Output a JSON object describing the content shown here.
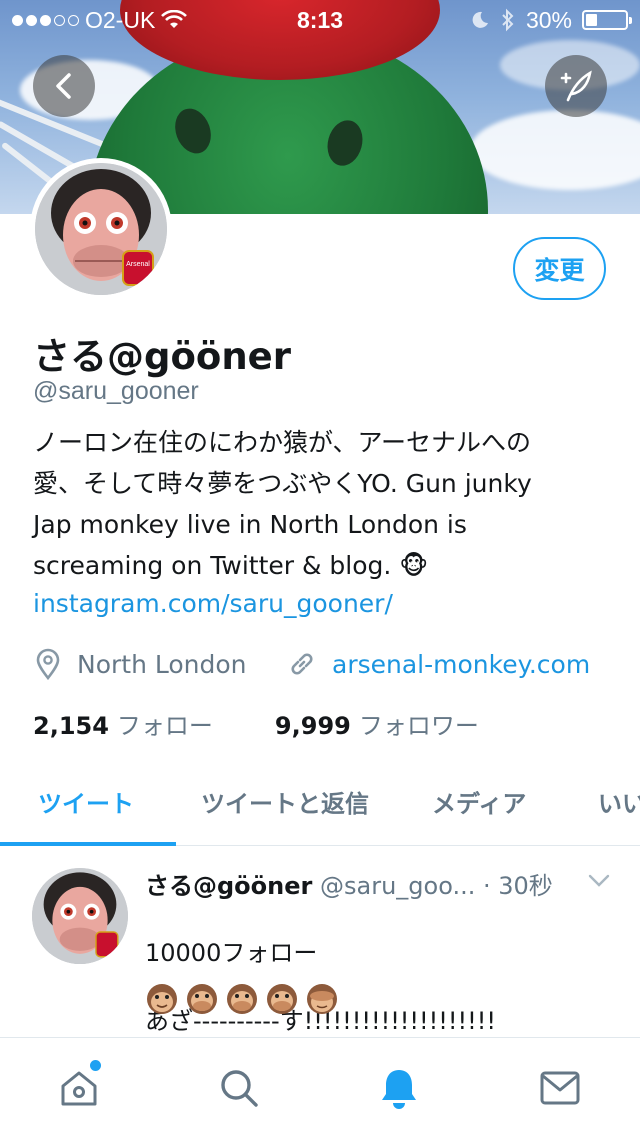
{
  "status_bar": {
    "carrier": "O2-UK",
    "time": "8:13",
    "battery": "30%",
    "battery_level": 0.3
  },
  "profile": {
    "name": "さる@gööner",
    "handle": "@saru_gooner",
    "edit_label": "変更",
    "bio_line1": "ノーロン在住のにわか猿が、アーセナルへの",
    "bio_line2": "愛、そして時々夢をつぶやくYO. Gun junky",
    "bio_line3": "Jap monkey live in North London is",
    "bio_line4": "screaming on Twitter & blog. 🐵",
    "bio_link": "instagram.com/saru_gooner/",
    "location": "North London",
    "website": "arsenal-monkey.com",
    "following_count": "2,154",
    "following_label": "フォロー",
    "followers_count": "9,999",
    "followers_label": "フォロワー"
  },
  "tabs": [
    {
      "label": "ツイート",
      "active": true
    },
    {
      "label": "ツイートと返信",
      "active": false
    },
    {
      "label": "メディア",
      "active": false
    },
    {
      "label": "いい",
      "active": false
    }
  ],
  "tweet": {
    "name": "さる@gööner",
    "handle": "@saru_goo...",
    "time": "· 30秒",
    "line1": "10000フォロー",
    "line2": "あざ----------す!!!!!!!!!!!!!!!!!!!!",
    "emojis": "🐵🙊🙊🙊🙈"
  },
  "bottom_nav": {
    "items": [
      "home-icon",
      "search-icon",
      "notifications-icon",
      "messages-icon"
    ],
    "active": "notifications-icon"
  },
  "colors": {
    "accent": "#1da1f2",
    "link": "#1b95e0",
    "muted": "#657786",
    "text": "#14171a"
  }
}
